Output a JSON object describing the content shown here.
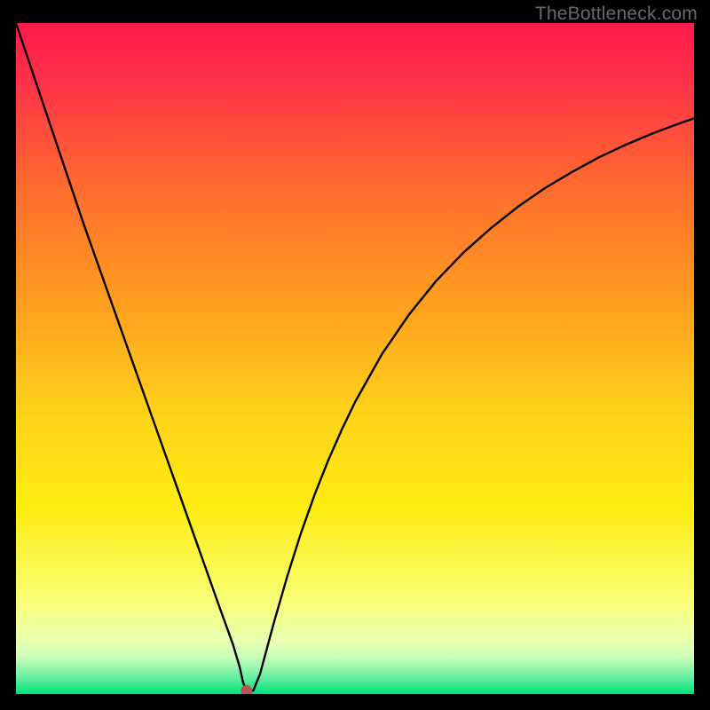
{
  "watermark": {
    "text": "TheBottleneck.com"
  },
  "palette": {
    "grad_top": "#ff1a4b",
    "grad_mid1": "#ff6a2f",
    "grad_mid2": "#ffbc1f",
    "grad_mid3": "#ffe712",
    "grad_band": "#f9ffa9",
    "grad_bottom": "#00e27a",
    "curve": "#000000",
    "marker": "#b25757",
    "frame_bg": "#000000"
  },
  "chart_data": {
    "type": "line",
    "title": "",
    "xlabel": "",
    "ylabel": "",
    "xlim": [
      0,
      100
    ],
    "ylim": [
      0,
      100
    ],
    "minimum_x": 34,
    "series": [
      {
        "name": "curve",
        "x": [
          0,
          2,
          4,
          6,
          8,
          10,
          12,
          14,
          16,
          18,
          20,
          22,
          24,
          26,
          28,
          30,
          31,
          32,
          33,
          33.5,
          34,
          35,
          36,
          38,
          40,
          42,
          44,
          46,
          48,
          50,
          54,
          58,
          62,
          66,
          70,
          74,
          78,
          82,
          86,
          90,
          94,
          98,
          100
        ],
        "y": [
          100,
          94,
          88,
          82,
          76,
          70,
          64.3,
          58.6,
          52.9,
          47.2,
          41.5,
          35.8,
          30.1,
          24.4,
          18.7,
          13.0,
          10.2,
          7.4,
          4.0,
          1.7,
          0.5,
          0.5,
          3.0,
          10.5,
          17.5,
          23.9,
          29.6,
          34.7,
          39.3,
          43.5,
          50.7,
          56.6,
          61.6,
          65.8,
          69.4,
          72.6,
          75.4,
          77.8,
          80.0,
          81.9,
          83.6,
          85.1,
          85.8
        ]
      }
    ],
    "marker": {
      "x": 34,
      "y": 0.5
    },
    "gradient_stops": [
      {
        "offset": 0.0,
        "color": "#ff1a4b"
      },
      {
        "offset": 0.08,
        "color": "#ff2f4a"
      },
      {
        "offset": 0.24,
        "color": "#ff6a2f"
      },
      {
        "offset": 0.43,
        "color": "#ffa21f"
      },
      {
        "offset": 0.58,
        "color": "#ffd21a"
      },
      {
        "offset": 0.72,
        "color": "#ffec12"
      },
      {
        "offset": 0.86,
        "color": "#f9ff75"
      },
      {
        "offset": 0.92,
        "color": "#eaffb0"
      },
      {
        "offset": 0.945,
        "color": "#caffb8"
      },
      {
        "offset": 0.97,
        "color": "#7cf0a8"
      },
      {
        "offset": 1.0,
        "color": "#00e27a"
      }
    ]
  }
}
